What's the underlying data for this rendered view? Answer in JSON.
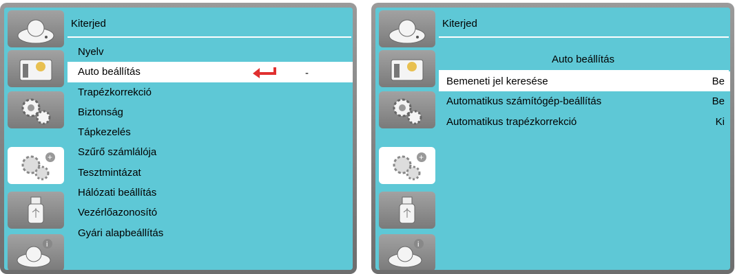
{
  "left": {
    "category_title": "Kiterjed",
    "menu_items": [
      "Nyelv",
      "Auto beállítás",
      "Trapézkorrekció",
      "Biztonság",
      "Tápkezelés",
      "Szűrő számlálója",
      "Tesztmintázat",
      "Hálózati beállítás",
      "Vezérlőazonosító",
      "Gyári alapbeállítás"
    ],
    "selected_index": 1,
    "dash": "-",
    "icons": [
      "camera-icon",
      "display-settings-icon",
      "gears-icon",
      "gears-plus-icon",
      "usb-icon",
      "camera-info-icon"
    ],
    "active_icon_index": 3
  },
  "right": {
    "category_title": "Kiterjed",
    "submenu_title": "Auto beállítás",
    "rows": [
      {
        "label": "Bemeneti jel keresése",
        "value": "Be"
      },
      {
        "label": "Automatikus számítógép-beállítás",
        "value": "Be"
      },
      {
        "label": "Automatikus trapézkorrekció",
        "value": "Ki"
      }
    ],
    "selected_index": 0
  },
  "colors": {
    "background": "#5ec8d6",
    "bezel": "#8a8a8a",
    "highlight": "#ffffff",
    "arrow": "#e03030"
  }
}
